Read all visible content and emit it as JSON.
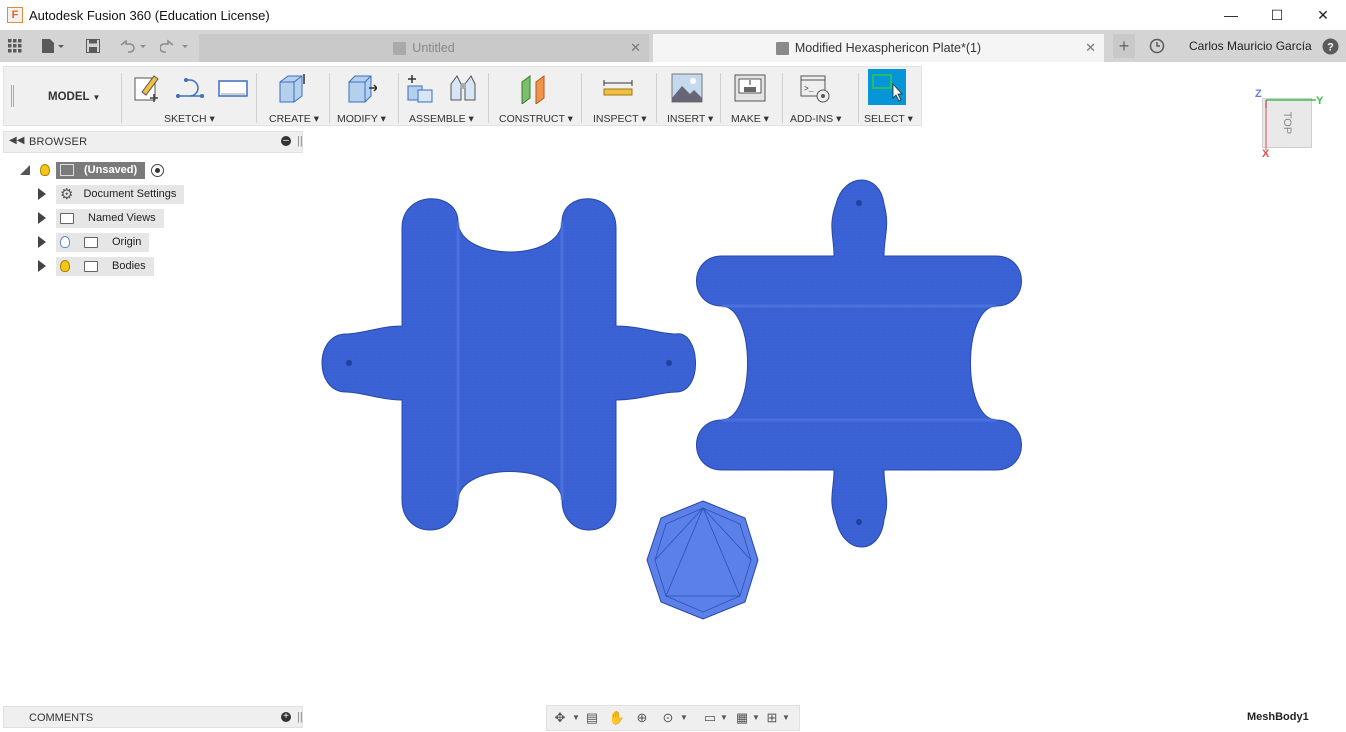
{
  "window": {
    "title": "Autodesk Fusion 360 (Education License)",
    "logo": "F",
    "minimize": "—",
    "maximize": "☐",
    "close": "✕"
  },
  "tabs": [
    {
      "label": "Untitled",
      "active": false
    },
    {
      "label": "Modified Hexasphericon Plate*(1)",
      "active": true
    }
  ],
  "user": {
    "name": "Carlos Mauricio García"
  },
  "toolbar": {
    "workspace": "MODEL",
    "groups": [
      "SKETCH",
      "CREATE",
      "MODIFY",
      "ASSEMBLE",
      "CONSTRUCT",
      "INSPECT",
      "INSERT",
      "MAKE",
      "ADD-INS",
      "SELECT"
    ]
  },
  "browser": {
    "title": "BROWSER",
    "root": "(Unsaved)",
    "items": [
      "Document Settings",
      "Named Views",
      "Origin",
      "Bodies"
    ]
  },
  "comments": {
    "title": "COMMENTS"
  },
  "viewcube": {
    "face": "TOP",
    "axes": [
      "Z",
      "Y",
      "X"
    ]
  },
  "status": {
    "selection": "MeshBody1"
  },
  "colors": {
    "mesh": "#3b63d6",
    "accent": "#0696d7"
  }
}
